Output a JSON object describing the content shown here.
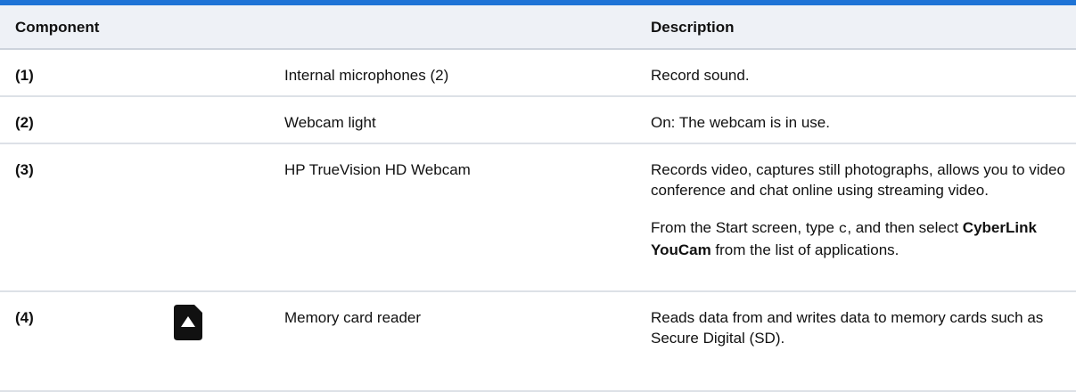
{
  "table": {
    "headers": {
      "component": "Component",
      "description": "Description"
    },
    "rows": [
      {
        "number": "(1)",
        "component": "Internal microphones (2)",
        "description": "Record sound."
      },
      {
        "number": "(2)",
        "component": "Webcam light",
        "description": "On: The webcam is in use."
      },
      {
        "number": "(3)",
        "component": "HP TrueVision HD Webcam",
        "description": "Records video, captures still photographs, allows you to video conference and chat online using streaming video.",
        "note": {
          "before": "From the Start screen, type ",
          "key": "c",
          "middle": ", and then select ",
          "app": "CyberLink YouCam",
          "after": " from the list of applications."
        }
      },
      {
        "number": "(4)",
        "component": "Memory card reader",
        "icon": "memory-card-icon",
        "description": "Reads data from and writes data to memory cards such as Secure Digital (SD)."
      }
    ]
  },
  "colors": {
    "accent_rule": "#1e73d6",
    "header_bg": "#eef1f6"
  }
}
